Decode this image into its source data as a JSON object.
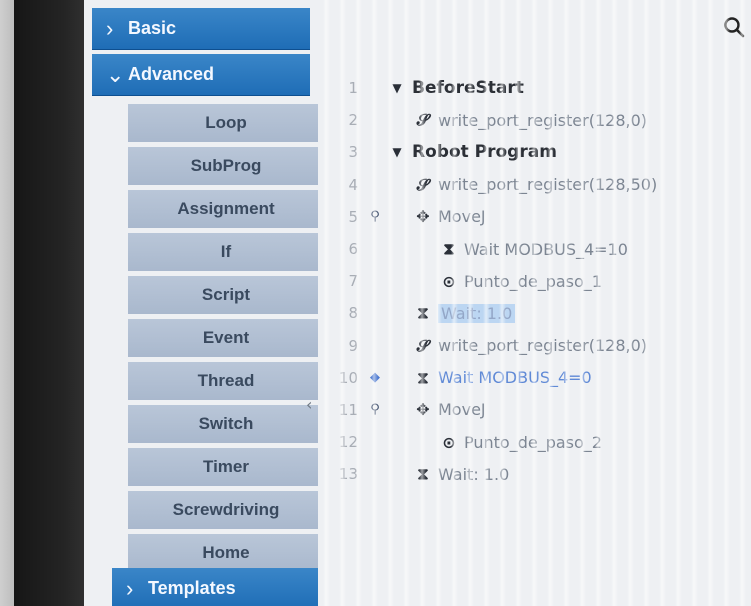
{
  "sidebar": {
    "basic_label": "Basic",
    "advanced_label": "Advanced",
    "templates_label": "Templates",
    "items": [
      {
        "label": "Loop"
      },
      {
        "label": "SubProg"
      },
      {
        "label": "Assignment"
      },
      {
        "label": "If"
      },
      {
        "label": "Script"
      },
      {
        "label": "Event"
      },
      {
        "label": "Thread"
      },
      {
        "label": "Switch"
      },
      {
        "label": "Timer"
      },
      {
        "label": "Screwdriving"
      },
      {
        "label": "Home"
      }
    ]
  },
  "icons": {
    "search": "search-icon",
    "chevron_right": "chevron-right-icon",
    "chevron_down": "chevron-down-icon",
    "collapse": "collapse-arrow-icon"
  },
  "program": {
    "lines": [
      {
        "n": "1",
        "text": "BeforeStart",
        "icon": "triangle-down-icon",
        "bold": true
      },
      {
        "n": "2",
        "text": "write_port_register(128,0)",
        "icon": "script-icon"
      },
      {
        "n": "3",
        "text": "Robot Program",
        "icon": "triangle-down-icon",
        "bold": true
      },
      {
        "n": "4",
        "text": "write_port_register(128,50)",
        "icon": "script-icon"
      },
      {
        "n": "5",
        "text": "MoveJ",
        "icon": "move-icon",
        "marker": "pin"
      },
      {
        "n": "6",
        "text": "Wait MODBUS_4=10",
        "icon": "hourglass-icon"
      },
      {
        "n": "7",
        "text": "Punto_de_paso_1",
        "icon": "waypoint-icon"
      },
      {
        "n": "8",
        "text": "Wait: 1.0",
        "icon": "hourglass-icon",
        "highlight": true
      },
      {
        "n": "9",
        "text": "write_port_register(128,0)",
        "icon": "script-icon"
      },
      {
        "n": "10",
        "text": "Wait MODBUS_4=0",
        "icon": "hourglass-icon",
        "marker": "current",
        "blue": true
      },
      {
        "n": "11",
        "text": "MoveJ",
        "icon": "move-icon",
        "marker": "pin"
      },
      {
        "n": "12",
        "text": "Punto_de_paso_2",
        "icon": "waypoint-icon"
      },
      {
        "n": "13",
        "text": "Wait: 1.0",
        "icon": "hourglass-icon"
      }
    ]
  },
  "colors": {
    "category_blue": "#2a7bc1",
    "item_bg": "#b3c1d4",
    "highlight": "#bcd6f2"
  }
}
